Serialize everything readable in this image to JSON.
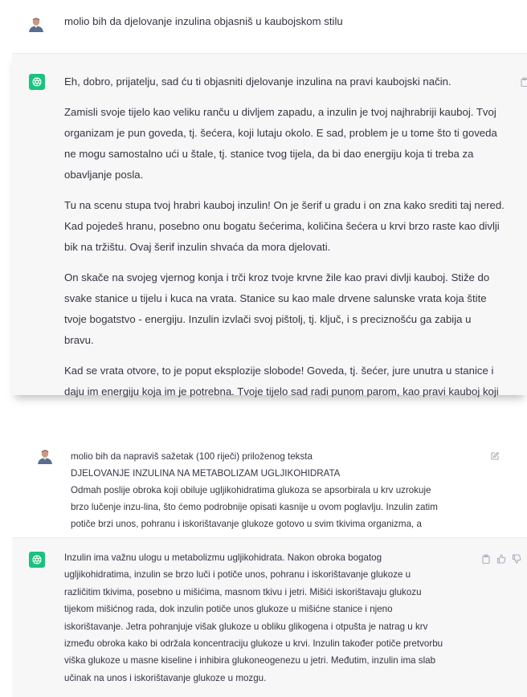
{
  "conversation_1": {
    "user_message": "molio bih da djelovanje inzulina objasniš u kaubojskom stilu",
    "assistant_paragraphs": [
      [
        "Eh, dobro, prijatelju, sad ću ti objasniti djelovanje inzulina na pravi kaubojski način."
      ],
      [
        "Zamisli svoje tijelo kao veliku ranču u divljem zapadu, a inzulin je tvoj najhrabriji kauboj. Tvoj",
        "organizam je pun goveda, tj. šećera, koji lutaju okolo. E sad, problem je u tome što ti goveda",
        "ne mogu samostalno ući u štale, tj. stanice tvog tijela, da bi dao energiju koja ti treba za",
        "obavljanje posla."
      ],
      [
        "Tu na scenu stupa tvoj hrabri kauboj inzulin! On je šerif u gradu i on zna kako srediti taj nered.",
        "Kad pojedeš hranu, posebno onu bogatu šećerima, količina šećera u krvi brzo raste kao divlji",
        "bik na tržištu. Ovaj šerif inzulin shvaća da mora djelovati."
      ],
      [
        "On skače na svojeg vjernog konja i trči kroz tvoje krvne žile kao pravi divlji kauboj. Stiže do",
        "svake stanice u tijelu i kuca na vrata. Stanice su kao male drvene salunske vrata koja štite",
        "tvoje bogatstvo - energiju. Inzulin izvlači svoj pištolj, tj. ključ, i s preciznošću ga zabija u",
        "bravu."
      ],
      [
        "Kad se vrata otvore, to je poput eksplozije slobode! Goveda, tj. šećer, jure unutra u stanice i",
        "daju im energiju koja im je potrebna. Tvoje tijelo sad radi punom parom, kao pravi kauboj koji"
      ]
    ]
  },
  "conversation_2": {
    "user_lines": [
      "molio bih da napraviš sažetak (100 riječi) priloženog teksta",
      "DJELOVANJE INZULINA NA METABOLIZAM UGLJIKOHIDRATA",
      "Odmah poslije obroka koji obiluje ugljikohidratima glukoza se apsorbirala u krv uzrokuje",
      "brzo lučenje inzu-lina, što ćemo podrobnije opisati kasnije u ovom poglavlju. Inzulin zatim",
      "potiče brzi unos, pohranu i iskorištavanje glukoze gotovo u svim tkivima organizma, a"
    ],
    "assistant_lines": [
      "Inzulin ima važnu ulogu u metabolizmu ugljikohidrata. Nakon obroka bogatog",
      "ugljikohidratima, inzulin se brzo luči i potiče unos, pohranu i iskorištavanje glukoze u",
      "različitim tkivima, posebno u mišićima, masnom tkivu i jetri. Mišići iskorištavaju glukozu",
      "tijekom mišićnog rada, dok inzulin potiče unos glukoze u mišićne stanice i njeno",
      "iskorištavanje. Jetra pohranjuje višak glukoze u obliku glikogena i otpušta je natrag u krv",
      "između obroka kako bi održala koncentraciju glukoze u krvi. Inzulin također potiče pretvorbu",
      "viška glukoze u masne kiseline i inhibira glukoneogenezu u jetri. Međutim, inzulin ima slab",
      "učinak na unos i iskorištavanje glukoze u mozgu."
    ]
  },
  "icons": {
    "user_avatar": "user-avatar",
    "assistant_logo": "openai-logo-icon",
    "copy": "clipboard-icon",
    "edit": "edit-icon",
    "thumbs_up": "thumbs-up-icon",
    "thumbs_down": "thumbs-down-icon"
  },
  "colors": {
    "assistant_bg": "#f7f7f8",
    "logo_green": "#19c37d",
    "text": "#343541",
    "icon_gray": "#acacbe"
  }
}
